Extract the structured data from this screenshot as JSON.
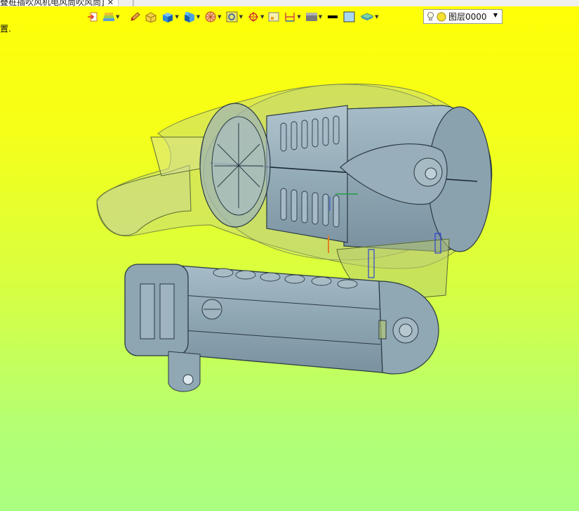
{
  "tab": {
    "title": "叠桩插吹风机电风筒吹风筒]",
    "close": "✕",
    "separator": "|"
  },
  "status_text": "置.",
  "toolbar": {
    "items": [
      {
        "name": "import-icon",
        "dropdown": false
      },
      {
        "name": "layers-stack-icon",
        "dropdown": true
      },
      {
        "name": "pen-icon",
        "dropdown": false
      },
      {
        "name": "box-edit-icon",
        "dropdown": false
      },
      {
        "name": "solid-cube-icon",
        "dropdown": true
      },
      {
        "name": "cube-face-icon",
        "dropdown": true
      },
      {
        "name": "sphere-view-icon",
        "dropdown": true
      },
      {
        "name": "zoom-box-icon",
        "dropdown": true
      },
      {
        "name": "target-icon",
        "dropdown": true
      },
      {
        "name": "frame-icon",
        "dropdown": false
      },
      {
        "name": "dimension-icon",
        "dropdown": true
      },
      {
        "name": "display-mode-icon",
        "dropdown": true
      },
      {
        "name": "line-color-icon",
        "dropdown": false
      },
      {
        "name": "fill-color-icon",
        "dropdown": false
      },
      {
        "name": "layer-manager-icon",
        "dropdown": true
      }
    ],
    "dropdown_glyph": "▼"
  },
  "layer": {
    "value": "图层0000",
    "caret": "▼"
  },
  "colors": {
    "bg_top": "#ffff06",
    "bg_bottom": "#aaff80",
    "model": "#8fa8b4",
    "shell": "#c7d870"
  }
}
